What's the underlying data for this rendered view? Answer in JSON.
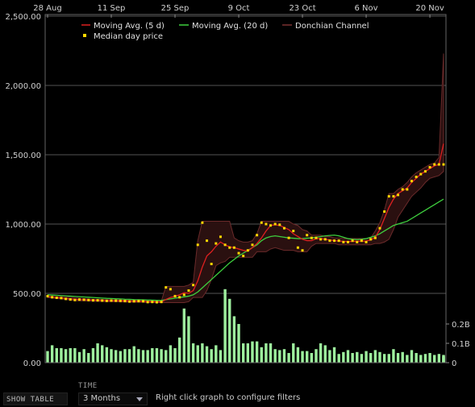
{
  "chart_data": {
    "type": "line",
    "x_dates": [
      "28 Aug",
      "29 Aug",
      "30 Aug",
      "31 Aug",
      "1 Sep",
      "2 Sep",
      "3 Sep",
      "4 Sep",
      "5 Sep",
      "6 Sep",
      "7 Sep",
      "8 Sep",
      "9 Sep",
      "10 Sep",
      "11 Sep",
      "12 Sep",
      "13 Sep",
      "14 Sep",
      "15 Sep",
      "16 Sep",
      "17 Sep",
      "18 Sep",
      "19 Sep",
      "20 Sep",
      "21 Sep",
      "22 Sep",
      "23 Sep",
      "24 Sep",
      "25 Sep",
      "26 Sep",
      "27 Sep",
      "28 Sep",
      "29 Sep",
      "30 Sep",
      "1 Oct",
      "2 Oct",
      "3 Oct",
      "4 Oct",
      "5 Oct",
      "6 Oct",
      "7 Oct",
      "8 Oct",
      "9 Oct",
      "10 Oct",
      "11 Oct",
      "12 Oct",
      "13 Oct",
      "14 Oct",
      "15 Oct",
      "16 Oct",
      "17 Oct",
      "18 Oct",
      "19 Oct",
      "20 Oct",
      "21 Oct",
      "22 Oct",
      "23 Oct",
      "24 Oct",
      "25 Oct",
      "26 Oct",
      "27 Oct",
      "28 Oct",
      "29 Oct",
      "30 Oct",
      "31 Oct",
      "1 Nov",
      "2 Nov",
      "3 Nov",
      "4 Nov",
      "5 Nov",
      "6 Nov",
      "7 Nov",
      "8 Nov",
      "9 Nov",
      "10 Nov",
      "11 Nov",
      "12 Nov",
      "13 Nov",
      "14 Nov",
      "15 Nov",
      "16 Nov",
      "17 Nov",
      "18 Nov",
      "19 Nov",
      "20 Nov",
      "21 Nov",
      "22 Nov",
      "23 Nov"
    ],
    "x_ticks": [
      "28 Aug",
      "11 Sep",
      "25 Sep",
      "9 Oct",
      "23 Oct",
      "6 Nov",
      "20 Nov"
    ],
    "y_ticks": [
      "0.00",
      "500.00",
      "1,000.00",
      "1,500.00",
      "2,000.00",
      "2,500.00"
    ],
    "ylim": [
      0,
      2500
    ],
    "volume_ticks": [
      "0",
      "0.1B",
      "0.2B"
    ],
    "volume_lim": [
      0,
      0.4
    ],
    "legend": {
      "ma5": "Moving Avg. (5 d)",
      "ma20": "Moving Avg. (20 d)",
      "donchian": "Donchian Channel",
      "median": "Median day price"
    },
    "series": [
      {
        "key": "median",
        "values": [
          480,
          472,
          468,
          466,
          460,
          456,
          452,
          455,
          454,
          452,
          450,
          450,
          448,
          446,
          448,
          447,
          446,
          445,
          441,
          443,
          444,
          443,
          437,
          438,
          436,
          438,
          543,
          530,
          480,
          472,
          490,
          520,
          560,
          850,
          1010,
          880,
          712,
          860,
          908,
          850,
          830,
          830,
          790,
          770,
          810,
          850,
          920,
          1010,
          1000,
          990,
          1000,
          995,
          970,
          900,
          950,
          830,
          810,
          920,
          900,
          900,
          890,
          890,
          880,
          880,
          880,
          870,
          870,
          880,
          870,
          880,
          870,
          890,
          900,
          970,
          1090,
          1200,
          1200,
          1210,
          1250,
          1250,
          1310,
          1340,
          1360,
          1380,
          1410,
          1430,
          1430,
          1430
        ],
        "color": "#ffd700"
      },
      {
        "key": "ma5",
        "values": [
          478,
          474,
          470,
          467,
          464,
          460,
          457,
          455,
          454,
          452,
          451,
          450,
          449,
          448,
          447,
          447,
          446,
          445,
          444,
          443,
          443,
          442,
          441,
          440,
          439,
          438,
          456,
          470,
          478,
          490,
          505,
          500,
          520,
          590,
          690,
          770,
          800,
          840,
          870,
          850,
          835,
          830,
          820,
          810,
          805,
          830,
          860,
          900,
          950,
          990,
          995,
          990,
          975,
          960,
          930,
          910,
          890,
          880,
          880,
          895,
          895,
          890,
          885,
          880,
          878,
          875,
          874,
          875,
          876,
          876,
          878,
          885,
          905,
          960,
          1040,
          1120,
          1180,
          1220,
          1240,
          1260,
          1300,
          1330,
          1360,
          1380,
          1400,
          1420,
          1430,
          1580
        ],
        "color": "#dd2020"
      },
      {
        "key": "ma20",
        "values": [
          490,
          488,
          486,
          484,
          482,
          480,
          478,
          476,
          474,
          472,
          470,
          468,
          466,
          464,
          463,
          461,
          460,
          458,
          457,
          455,
          454,
          453,
          452,
          451,
          450,
          449,
          455,
          460,
          465,
          470,
          475,
          480,
          490,
          510,
          540,
          570,
          600,
          630,
          660,
          690,
          720,
          745,
          770,
          790,
          810,
          830,
          850,
          880,
          900,
          910,
          915,
          910,
          905,
          900,
          898,
          895,
          895,
          898,
          900,
          905,
          910,
          915,
          918,
          920,
          915,
          905,
          895,
          890,
          888,
          890,
          895,
          905,
          915,
          930,
          950,
          970,
          990,
          1000,
          1010,
          1020,
          1040,
          1060,
          1080,
          1100,
          1120,
          1140,
          1160,
          1180
        ],
        "color": "#3ecf3e"
      },
      {
        "key": "donchian_upper",
        "values": [
          490,
          488,
          485,
          482,
          478,
          472,
          468,
          466,
          462,
          460,
          458,
          458,
          456,
          454,
          454,
          453,
          452,
          451,
          450,
          449,
          449,
          448,
          447,
          446,
          446,
          445,
          550,
          550,
          550,
          550,
          550,
          560,
          580,
          880,
          1020,
          1020,
          1020,
          1020,
          1020,
          1020,
          1020,
          900,
          880,
          870,
          870,
          880,
          930,
          1020,
          1020,
          1020,
          1020,
          1020,
          1020,
          1020,
          1000,
          990,
          960,
          950,
          920,
          920,
          920,
          910,
          910,
          900,
          900,
          895,
          895,
          895,
          895,
          895,
          895,
          900,
          950,
          1010,
          1100,
          1220,
          1220,
          1250,
          1270,
          1300,
          1340,
          1370,
          1390,
          1410,
          1430,
          1440,
          1480,
          2230
        ],
        "color": "#6a2a2a"
      },
      {
        "key": "donchian_lower",
        "values": [
          470,
          466,
          462,
          460,
          456,
          452,
          448,
          446,
          446,
          444,
          442,
          442,
          441,
          440,
          440,
          439,
          438,
          437,
          436,
          436,
          436,
          435,
          434,
          434,
          434,
          433,
          433,
          433,
          433,
          433,
          433,
          440,
          470,
          470,
          470,
          520,
          600,
          700,
          720,
          730,
          760,
          760,
          760,
          760,
          760,
          760,
          800,
          800,
          800,
          820,
          830,
          820,
          810,
          810,
          810,
          800,
          800,
          800,
          840,
          860,
          860,
          860,
          860,
          860,
          850,
          850,
          850,
          850,
          850,
          850,
          850,
          850,
          860,
          860,
          870,
          890,
          960,
          1050,
          1100,
          1150,
          1200,
          1230,
          1260,
          1300,
          1330,
          1340,
          1350,
          1380
        ],
        "color": "#6a2a2a"
      },
      {
        "key": "volume",
        "values": [
          0.06,
          0.09,
          0.075,
          0.075,
          0.07,
          0.075,
          0.075,
          0.055,
          0.07,
          0.05,
          0.075,
          0.1,
          0.09,
          0.08,
          0.07,
          0.065,
          0.06,
          0.07,
          0.07,
          0.085,
          0.07,
          0.065,
          0.065,
          0.075,
          0.075,
          0.07,
          0.065,
          0.09,
          0.075,
          0.13,
          0.28,
          0.24,
          0.1,
          0.09,
          0.1,
          0.085,
          0.07,
          0.09,
          0.065,
          0.38,
          0.33,
          0.24,
          0.2,
          0.1,
          0.1,
          0.11,
          0.11,
          0.08,
          0.1,
          0.1,
          0.07,
          0.065,
          0.07,
          0.05,
          0.1,
          0.08,
          0.06,
          0.06,
          0.05,
          0.07,
          0.1,
          0.09,
          0.065,
          0.08,
          0.045,
          0.055,
          0.065,
          0.05,
          0.055,
          0.045,
          0.06,
          0.05,
          0.065,
          0.055,
          0.045,
          0.045,
          0.07,
          0.05,
          0.055,
          0.04,
          0.065,
          0.05,
          0.04,
          0.045,
          0.05,
          0.04,
          0.045,
          0.04,
          0.03,
          0.035,
          0.01
        ],
        "color": "#9ef09e"
      }
    ]
  },
  "controls": {
    "show_table_label": "SHOW TABLE",
    "time_label": "TIME",
    "range_value": "3 Months",
    "hint_text": "Right click graph to configure filters"
  }
}
